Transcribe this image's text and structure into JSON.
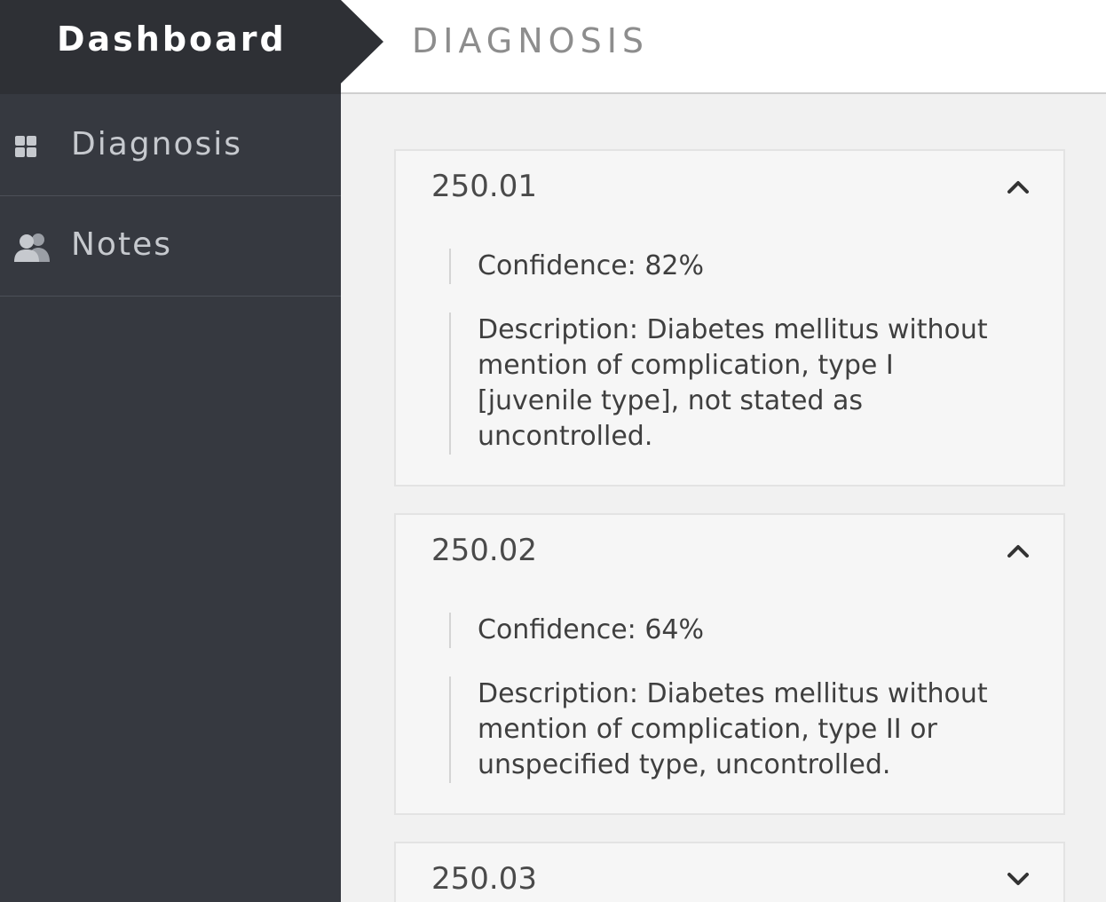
{
  "brand": {
    "title": "Dashboard"
  },
  "nav": {
    "items": [
      {
        "label": "Diagnosis",
        "icon": "grid-icon"
      },
      {
        "label": "Notes",
        "icon": "users-icon"
      }
    ]
  },
  "header": {
    "title": "DIAGNOSIS"
  },
  "diagnoses": [
    {
      "code": "250.01",
      "expanded": true,
      "confidence": "Confidence: 82%",
      "description": "Description: Diabetes mellitus without mention of complication, type I [juvenile type], not stated as uncontrolled."
    },
    {
      "code": "250.02",
      "expanded": true,
      "confidence": "Confidence: 64%",
      "description": "Description: Diabetes mellitus without mention of complication, type II or unspecified type, uncontrolled."
    },
    {
      "code": "250.03",
      "expanded": false
    }
  ],
  "colors": {
    "sidebar": "#363940",
    "brand": "#2e3035",
    "nav_text": "#c6c9ce",
    "title_gray": "#8d8d8d"
  }
}
